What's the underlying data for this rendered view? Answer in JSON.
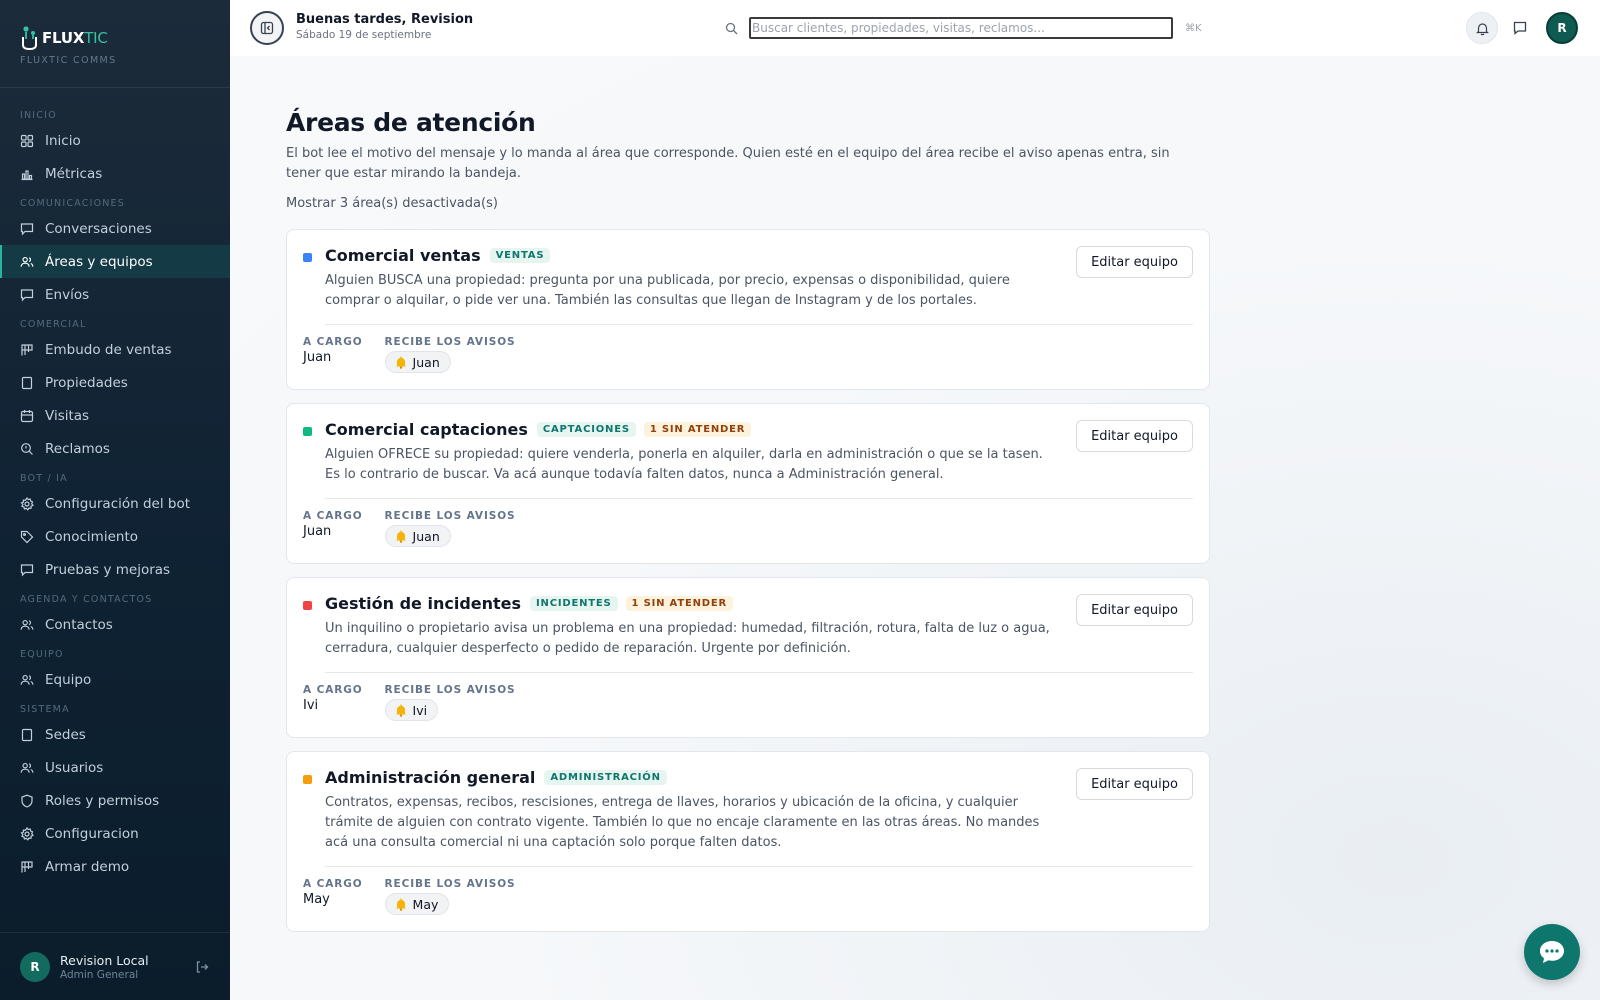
{
  "brand": {
    "name_main": "FLUX",
    "name_accent": "TIC",
    "subtitle": "FLUXTIC COMMS",
    "logo_icon": "logo-icon"
  },
  "sidebar": {
    "sections": [
      {
        "label": "INICIO",
        "items": [
          {
            "label": "Inicio",
            "icon": "grid-icon"
          },
          {
            "label": "Métricas",
            "icon": "bar-chart-icon"
          }
        ]
      },
      {
        "label": "COMUNICACIONES",
        "items": [
          {
            "label": "Conversaciones",
            "icon": "message-icon"
          },
          {
            "label": "Áreas y equipos",
            "icon": "users-icon",
            "active": true
          },
          {
            "label": "Envíos",
            "icon": "message-icon"
          }
        ]
      },
      {
        "label": "COMERCIAL",
        "items": [
          {
            "label": "Embudo de ventas",
            "icon": "kanban-icon"
          },
          {
            "label": "Propiedades",
            "icon": "building-icon"
          },
          {
            "label": "Visitas",
            "icon": "calendar-icon"
          },
          {
            "label": "Reclamos",
            "icon": "search-alert-icon"
          }
        ]
      },
      {
        "label": "BOT / IA",
        "items": [
          {
            "label": "Configuración del bot",
            "icon": "gear-icon"
          },
          {
            "label": "Conocimiento",
            "icon": "tag-icon"
          },
          {
            "label": "Pruebas y mejoras",
            "icon": "message-icon"
          }
        ]
      },
      {
        "label": "AGENDA Y CONTACTOS",
        "items": [
          {
            "label": "Contactos",
            "icon": "users-icon"
          }
        ]
      },
      {
        "label": "EQUIPO",
        "items": [
          {
            "label": "Equipo",
            "icon": "users-icon"
          }
        ]
      },
      {
        "label": "SISTEMA",
        "items": [
          {
            "label": "Sedes",
            "icon": "building-icon"
          },
          {
            "label": "Usuarios",
            "icon": "users-icon"
          },
          {
            "label": "Roles y permisos",
            "icon": "shield-icon"
          },
          {
            "label": "Configuracion",
            "icon": "gear-icon"
          },
          {
            "label": "Armar demo",
            "icon": "kanban-icon"
          }
        ]
      }
    ],
    "user": {
      "initial": "R",
      "name": "Revision Local",
      "role": "Admin General"
    }
  },
  "topbar": {
    "greeting": "Buenas tardes, Revision",
    "date": "Sábado 19 de septiembre",
    "search_placeholder": "Buscar clientes, propiedades, visitas, reclamos...",
    "search_value": "",
    "shortcut": "⌘K",
    "avatar_initial": "R"
  },
  "page": {
    "title": "Áreas de atención",
    "description": "El bot lee el motivo del mensaje y lo manda al área que corresponde. Quien esté en el equipo del área recibe el aviso apenas entra, sin tener que estar mirando la bandeja.",
    "show_disabled": "Mostrar 3 área(s) desactivada(s)"
  },
  "areas": [
    {
      "title": "Comercial ventas",
      "tag": "VENTAS",
      "badge": "",
      "color": "#3b82f6",
      "description": "Alguien BUSCA una propiedad: pregunta por una publicada, por precio, expensas o disponibilidad, quiere comprar o alquilar, o pide ver una. También las consultas que llegan de Instagram y de los portales.",
      "edit_label": "Editar equipo",
      "owner_label": "A CARGO",
      "owner": "Juan",
      "notify_label": "RECIBE LOS AVISOS",
      "notify": [
        "Juan"
      ]
    },
    {
      "title": "Comercial captaciones",
      "tag": "CAPTACIONES",
      "badge": "1 SIN ATENDER",
      "color": "#10b981",
      "description": "Alguien OFRECE su propiedad: quiere venderla, ponerla en alquiler, darla en administración o que se la tasen. Es lo contrario de buscar. Va acá aunque todavía falten datos, nunca a Administración general.",
      "edit_label": "Editar equipo",
      "owner_label": "A CARGO",
      "owner": "Juan",
      "notify_label": "RECIBE LOS AVISOS",
      "notify": [
        "Juan"
      ]
    },
    {
      "title": "Gestión de incidentes",
      "tag": "INCIDENTES",
      "badge": "1 SIN ATENDER",
      "color": "#ef4444",
      "description": "Un inquilino o propietario avisa un problema en una propiedad: humedad, filtración, rotura, falta de luz o agua, cerradura, cualquier desperfecto o pedido de reparación. Urgente por definición.",
      "edit_label": "Editar equipo",
      "owner_label": "A CARGO",
      "owner": "Ivi",
      "notify_label": "RECIBE LOS AVISOS",
      "notify": [
        "Ivi"
      ]
    },
    {
      "title": "Administración general",
      "tag": "ADMINISTRACIÓN",
      "badge": "",
      "color": "#f59e0b",
      "description": "Contratos, expensas, recibos, rescisiones, entrega de llaves, horarios y ubicación de la oficina, y cualquier trámite de alguien con contrato vigente. También lo que no encaje claramente en las otras áreas. No mandes acá una consulta comercial ni una captación solo porque falten datos.",
      "edit_label": "Editar equipo",
      "owner_label": "A CARGO",
      "owner": "May",
      "notify_label": "RECIBE LOS AVISOS",
      "notify": [
        "May"
      ]
    }
  ],
  "fab_icon": "chat-bubble-icon"
}
